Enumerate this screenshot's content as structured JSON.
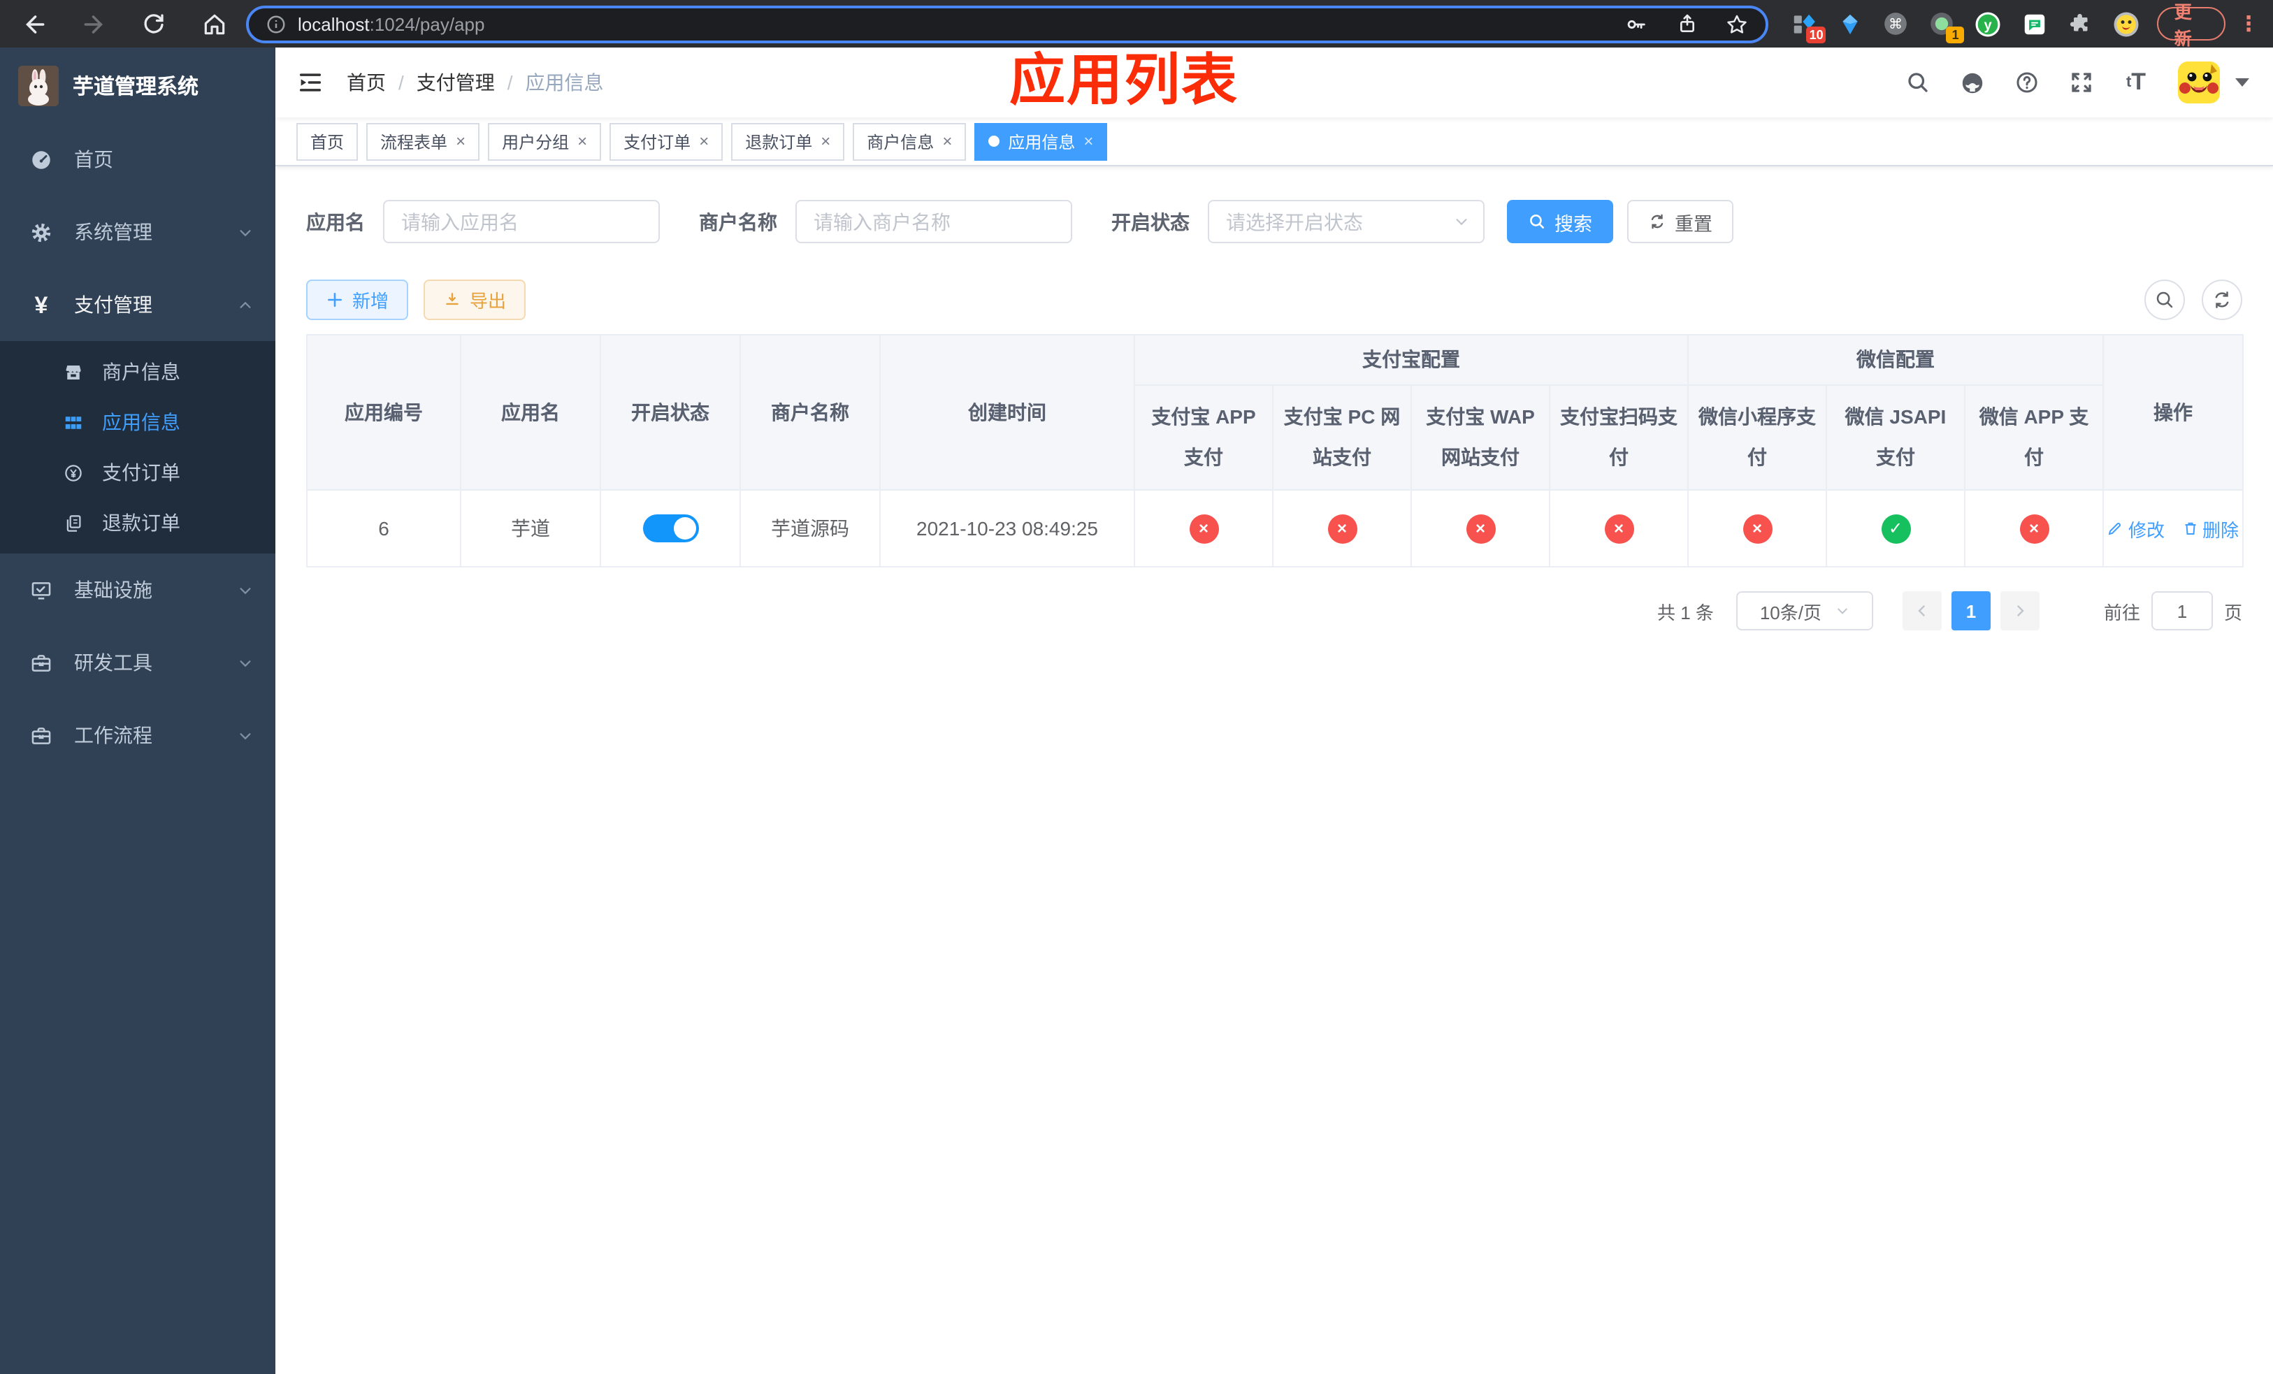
{
  "browser": {
    "url_host": "localhost",
    "url_rest": ":1024/pay/app",
    "update_label": "更新",
    "ext_badge_grid": "10",
    "ext_badge_record": "1",
    "menu_dots": "⋮"
  },
  "annotation": {
    "title": "应用列表"
  },
  "sidebar": {
    "logo_title": "芋道管理系统",
    "items": [
      {
        "label": "首页",
        "expandable": false
      },
      {
        "label": "系统管理",
        "expandable": true,
        "expanded": false
      },
      {
        "label": "支付管理",
        "expandable": true,
        "expanded": true,
        "active": true
      },
      {
        "label": "基础设施",
        "expandable": true,
        "expanded": false
      },
      {
        "label": "研发工具",
        "expandable": true,
        "expanded": false
      },
      {
        "label": "工作流程",
        "expandable": true,
        "expanded": false
      }
    ],
    "submenu": [
      {
        "label": "商户信息",
        "active": false
      },
      {
        "label": "应用信息",
        "active": true
      },
      {
        "label": "支付订单",
        "active": false
      },
      {
        "label": "退款订单",
        "active": false
      }
    ]
  },
  "breadcrumb": {
    "items": [
      "首页",
      "支付管理",
      "应用信息"
    ],
    "separator": "/"
  },
  "tabs": [
    {
      "label": "首页",
      "closable": false,
      "active": false
    },
    {
      "label": "流程表单",
      "closable": true,
      "active": false
    },
    {
      "label": "用户分组",
      "closable": true,
      "active": false
    },
    {
      "label": "支付订单",
      "closable": true,
      "active": false
    },
    {
      "label": "退款订单",
      "closable": true,
      "active": false
    },
    {
      "label": "商户信息",
      "closable": true,
      "active": false
    },
    {
      "label": "应用信息",
      "closable": true,
      "active": true
    }
  ],
  "filters": {
    "app_name_label": "应用名",
    "app_name_placeholder": "请输入应用名",
    "merchant_label": "商户名称",
    "merchant_placeholder": "请输入商户名称",
    "status_label": "开启状态",
    "status_placeholder": "请选择开启状态",
    "search_label": "搜索",
    "reset_label": "重置"
  },
  "toolbar": {
    "add_label": "新增",
    "export_label": "导出"
  },
  "table": {
    "columns": [
      "应用编号",
      "应用名",
      "开启状态",
      "商户名称",
      "创建时间"
    ],
    "group_alipay": "支付宝配置",
    "group_wechat": "微信配置",
    "alipay_cols": [
      "支付宝 APP 支付",
      "支付宝 PC 网站支付",
      "支付宝 WAP 网站支付",
      "支付宝扫码支付"
    ],
    "wechat_cols": [
      "微信小程序支付",
      "微信 JSAPI 支付",
      "微信 APP 支付"
    ],
    "ops_col": "操作",
    "rows": [
      {
        "id": "6",
        "name": "芋道",
        "enabled": true,
        "merchant": "芋道源码",
        "created": "2021-10-23 08:49:25",
        "statuses": [
          "no",
          "no",
          "no",
          "no",
          "no",
          "yes",
          "no"
        ],
        "edit_label": "修改",
        "delete_label": "删除"
      }
    ]
  },
  "pagination": {
    "total": "共 1 条",
    "page_size": "10条/页",
    "current": "1",
    "goto_prefix": "前往",
    "goto_value": "1",
    "goto_suffix": "页"
  },
  "colors": {
    "accent": "#409eff",
    "sidebar_bg": "#304156",
    "submenu_bg": "#1f2d3d",
    "status_fail": "#f8524e",
    "status_ok": "#17c05e",
    "annotation_red": "#fb2d09",
    "warning": "#e6a23c"
  }
}
